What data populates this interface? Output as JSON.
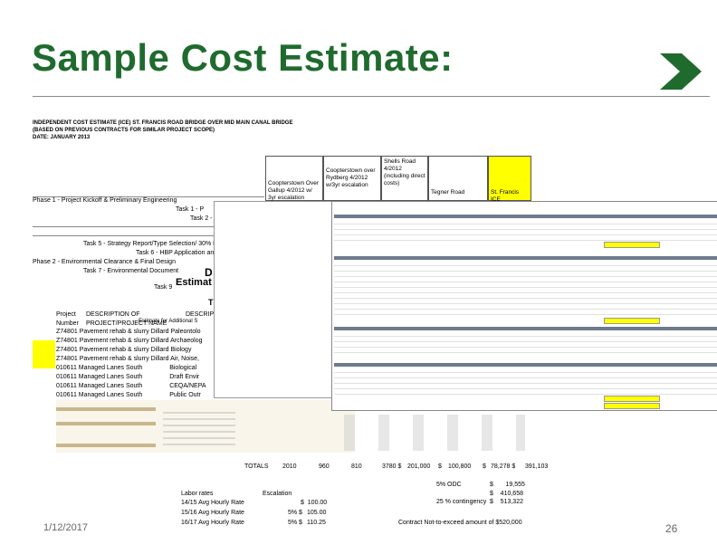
{
  "slide": {
    "title": "Sample Cost Estimate:",
    "date": "1/12/2017",
    "page_number": "26",
    "accent_color": "#1f6b2e"
  },
  "estimate": {
    "header_line1": "INDEPENDENT COST ESTIMATE (ICE) ST. FRANCIS ROAD BRIDGE OVER MID MAIN CANAL BRIDGE",
    "header_line2": "(BASED ON PREVIOUS CONTRACTS FOR SIMILAR PROJECT SCOPE)",
    "header_line3": "DATE: JANUARY 2013",
    "columns": [
      "Coopterstown Over Gallup 4/2012 w/ 3yr escalation",
      "Coopterstown over Rydberg 4/2012 w/3yr escalation",
      "Shells Road 4/2012 (including direct costs)",
      "Tegner Road",
      "St. Francis ICE"
    ],
    "phase1": "Phase 1 - Project Kickoff & Preliminary Engineering",
    "task1": "Task 1 - P",
    "task2": "Task 2 -",
    "task5": "Task 5 - Strategy Report/Type Selection/ 30% Pl",
    "task6": "Task 6 - HBP Application an",
    "phase2": "Phase 2 - Environmental Clearance & Final Design",
    "task7": "Task 7 - Environmental Document",
    "task9": "Task 9",
    "overlay_d": "D",
    "overlay_estimat": "Estimat",
    "overlay_t": "T",
    "project_header": "Project",
    "number_header": "Number",
    "desc_header": "DESCRIPTION OF",
    "proj_name_header": "PROJECT/PROJECT NAME",
    "desc2_header": "DESCRIP",
    "estimate_for_header": "Estimate for Additional S",
    "rows": [
      {
        "num": "Z74801",
        "name": "Pavement rehab & slurry Dillard",
        "desc": "Paleontolo"
      },
      {
        "num": "Z74801",
        "name": "Pavement rehab & slurry Dillard",
        "desc": "Archaeolog"
      },
      {
        "num": "Z74801",
        "name": "Pavement rehab & slurry Dillard",
        "desc": "Biology"
      },
      {
        "num": "Z74801",
        "name": "Pavement rehab & slurry Dillard",
        "desc": "Air, Noise,"
      },
      {
        "num": "010611",
        "name": "Managed Lanes South",
        "desc": "Biological"
      },
      {
        "num": "010611",
        "name": "Managed Lanes South",
        "desc": "Draft Envir"
      },
      {
        "num": "010611",
        "name": "Managed Lanes South",
        "desc": "CEQA/NEPA"
      },
      {
        "num": "010611",
        "name": "Managed Lanes South",
        "desc": "Public Outr"
      }
    ],
    "totals_label": "TOTALS",
    "totals_values": [
      "2010",
      "960",
      "810",
      "3780 $",
      "201,000",
      "$",
      "100,800",
      "$",
      "78,278 $",
      "391,103"
    ],
    "odc_label": "5% ODC",
    "odc_value": "$       19,555",
    "subtotal_value": "$    410,658",
    "contingency_label": "25 % contingency",
    "contingency_value": "$    513,322",
    "not_to_exceed": "Contract Not-to-exceed amount of $520,000",
    "labor_rates_label": "Labor rates",
    "escalation_label": "Escalation",
    "rate_rows": [
      {
        "label": "14/15 Avg Hourly Rate",
        "pct": "",
        "value": "$  100.00"
      },
      {
        "label": "15/16 Avg Hourly Rate",
        "pct": "5% $",
        "value": "105.00"
      },
      {
        "label": "16/17 Avg Hourly Rate",
        "pct": "5% $",
        "value": "110.25"
      }
    ]
  }
}
